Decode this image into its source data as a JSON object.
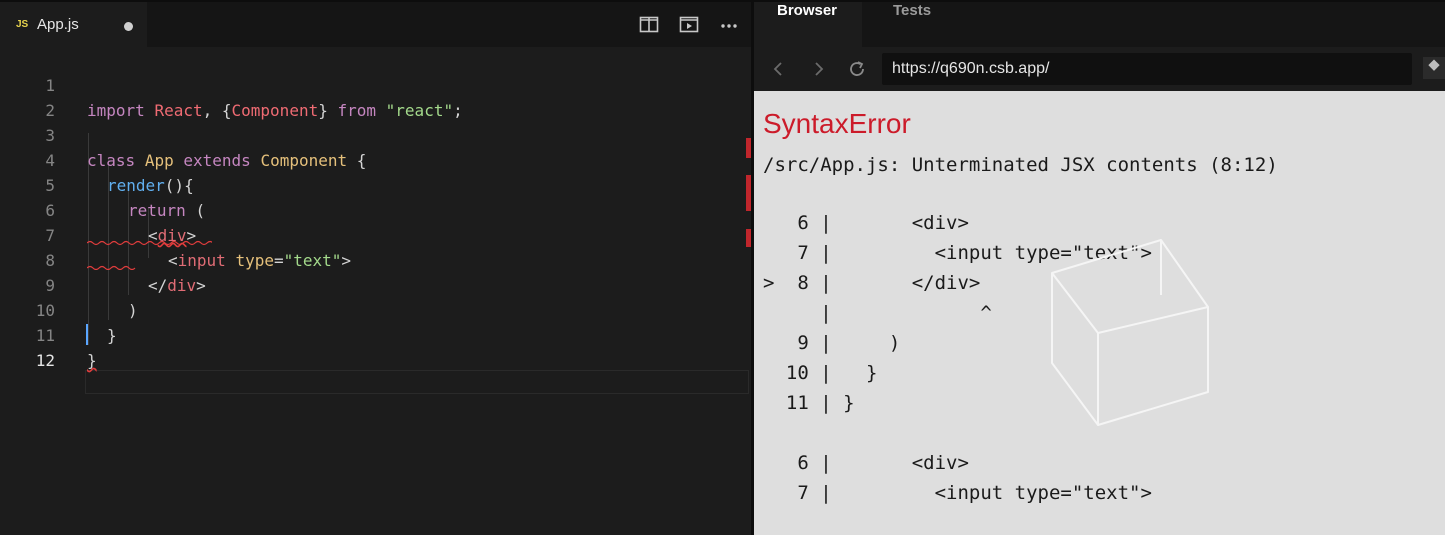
{
  "editor": {
    "tab": {
      "badge": "JS",
      "filename": "App.js"
    },
    "actions": [
      {
        "name": "split-editor-icon"
      },
      {
        "name": "preview-icon"
      },
      {
        "name": "more-icon"
      }
    ],
    "active_line": 12,
    "lines": [
      {
        "num": "1"
      },
      {
        "num": "2"
      },
      {
        "num": "3"
      },
      {
        "num": "4"
      },
      {
        "num": "5"
      },
      {
        "num": "6"
      },
      {
        "num": "7"
      },
      {
        "num": "8"
      },
      {
        "num": "9"
      },
      {
        "num": "10"
      },
      {
        "num": "11"
      },
      {
        "num": "12"
      }
    ],
    "tokens": {
      "l1": [
        "import",
        "React",
        ", {",
        "Component",
        "} ",
        "from",
        "\"react\"",
        ";"
      ],
      "l3": [
        "class",
        "App",
        "extends",
        "Component",
        "{"
      ],
      "l4": [
        "render",
        "(){"
      ],
      "l5": [
        "return",
        "("
      ],
      "l6": [
        "<",
        "div",
        ">"
      ],
      "l7": [
        "<",
        "input",
        "type",
        "=",
        "\"text\"",
        ">"
      ],
      "l8": [
        "</",
        "div",
        ">"
      ],
      "l9": [
        ")"
      ],
      "l10": [
        "}"
      ],
      "l11": [
        "}"
      ]
    }
  },
  "browser": {
    "tabs": [
      "Browser",
      "Tests"
    ],
    "active_tab": "Browser",
    "url": "https://q690n.csb.app/",
    "error": {
      "title": "SyntaxError",
      "message": "/src/App.js: Unterminated JSX contents (8:12)",
      "frame": [
        {
          "text": "   6 |       <div>"
        },
        {
          "text": "   7 |         <input type=\"text\">"
        },
        {
          "text": ">  8 |       </div>"
        },
        {
          "text": "     |             ^"
        },
        {
          "text": "   9 |     )"
        },
        {
          "text": "  10 |   }"
        },
        {
          "text": "  11 | }"
        },
        {
          "text": ""
        },
        {
          "text": "   6 |       <div>"
        },
        {
          "text": "   7 |         <input type=\"text\">"
        }
      ]
    }
  }
}
